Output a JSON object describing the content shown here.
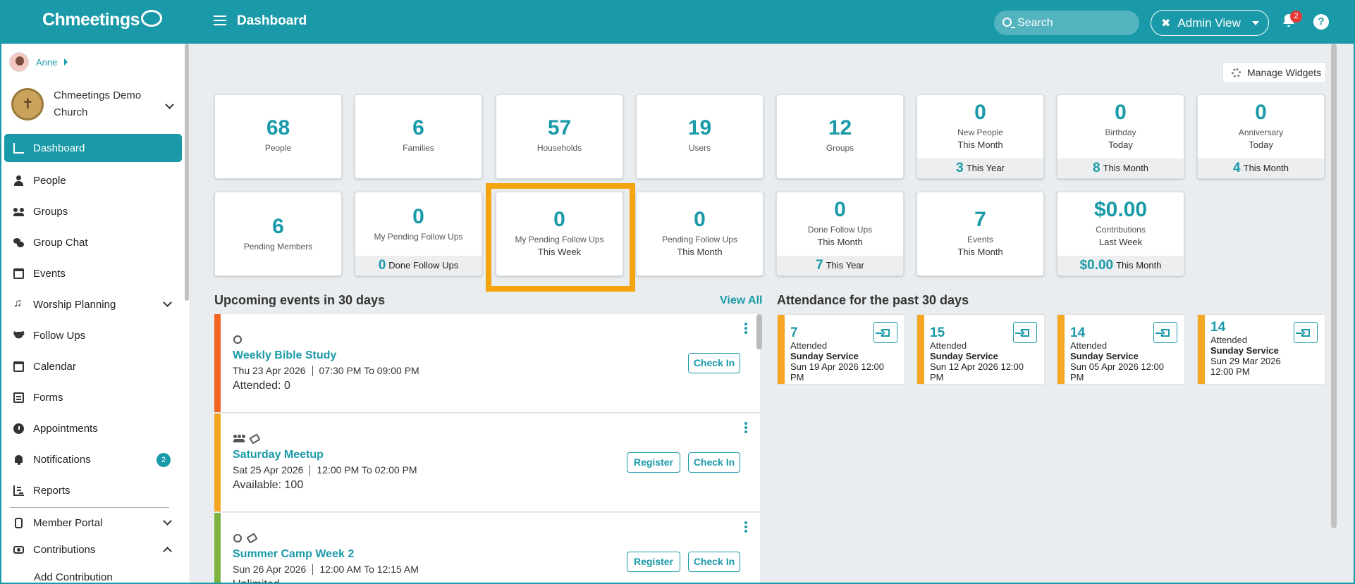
{
  "header": {
    "brand": "Chmeetings",
    "title": "Dashboard",
    "search_placeholder": "Search",
    "admin_view": "Admin View",
    "notif_count": "2",
    "help": "?"
  },
  "sidebar": {
    "user": "Anne",
    "church": "Chmeetings Demo Church",
    "items": [
      {
        "label": "Dashboard",
        "icon": "dashboard-icon"
      },
      {
        "label": "People",
        "icon": "person-icon"
      },
      {
        "label": "Groups",
        "icon": "groups-icon"
      },
      {
        "label": "Group Chat",
        "icon": "chat-icon"
      },
      {
        "label": "Events",
        "icon": "calendar-icon"
      },
      {
        "label": "Worship Planning",
        "icon": "music-icon"
      },
      {
        "label": "Follow Ups",
        "icon": "handshake-icon"
      },
      {
        "label": "Calendar",
        "icon": "calendar-icon"
      },
      {
        "label": "Forms",
        "icon": "forms-icon"
      },
      {
        "label": "Appointments",
        "icon": "clock-icon"
      },
      {
        "label": "Notifications",
        "icon": "bell-icon",
        "badge": "2"
      },
      {
        "label": "Reports",
        "icon": "reports-icon"
      },
      {
        "label": "Member Portal",
        "icon": "phone-icon"
      },
      {
        "label": "Contributions",
        "icon": "money-icon"
      },
      {
        "label": "Add Contribution"
      }
    ]
  },
  "manage_widgets": "Manage Widgets",
  "stats_row1": [
    {
      "num": "68",
      "label": "People"
    },
    {
      "num": "6",
      "label": "Families"
    },
    {
      "num": "57",
      "label": "Households"
    },
    {
      "num": "19",
      "label": "Users"
    },
    {
      "num": "12",
      "label": "Groups"
    },
    {
      "num": "0",
      "label": "New People",
      "sub": "This Month",
      "foot_num": "3",
      "foot": "This Year"
    },
    {
      "num": "0",
      "label": "Birthday",
      "sub": "Today",
      "foot_num": "8",
      "foot": "This Month"
    },
    {
      "num": "0",
      "label": "Anniversary",
      "sub": "Today",
      "foot_num": "4",
      "foot": "This Month"
    }
  ],
  "stats_row2": [
    {
      "num": "6",
      "label": "Pending Members"
    },
    {
      "num": "0",
      "label": "My Pending Follow Ups",
      "foot_num": "0",
      "foot": "Done Follow Ups"
    },
    {
      "num": "0",
      "label": "My Pending Follow Ups",
      "sub": "This Week"
    },
    {
      "num": "0",
      "label": "Pending Follow Ups",
      "sub": "This Month"
    },
    {
      "num": "0",
      "label": "Done Follow Ups",
      "sub": "This Month",
      "foot_num": "7",
      "foot": "This Year"
    },
    {
      "num": "7",
      "label": "Events",
      "sub": "This Month"
    },
    {
      "num": "$0.00",
      "label": "Contributions",
      "sub": "Last Week",
      "foot_num": "$0.00",
      "foot": "This Month"
    }
  ],
  "upcoming": {
    "title": "Upcoming events in 30 days",
    "view_all": "View All",
    "events": [
      {
        "name": "Weekly Bible Study",
        "date": "Thu 23 Apr  2026",
        "time": "07:30 PM To 09:00 PM",
        "meta": "Attended: 0",
        "color": "#f26522",
        "register": false
      },
      {
        "name": "Saturday Meetup",
        "date": "Sat 25 Apr  2026",
        "time": "12:00 PM To 02:00 PM",
        "meta": "Available: 100",
        "color": "#f5a623",
        "register": true
      },
      {
        "name": "Summer Camp Week 2",
        "date": "Sun 26 Apr  2026",
        "time": "12:00 AM To 12:15 AM",
        "meta": "Unlimited",
        "color": "#7cb342",
        "register": true
      }
    ],
    "register_label": "Register",
    "checkin_label": "Check In"
  },
  "attendance": {
    "title": "Attendance for the past 30 days",
    "cards": [
      {
        "num": "7",
        "label": "Attended",
        "name": "Sunday Service",
        "date": "Sun 19 Apr 2026 12:00 PM"
      },
      {
        "num": "15",
        "label": "Attended",
        "name": "Sunday Service",
        "date": "Sun 12 Apr 2026 12:00 PM"
      },
      {
        "num": "14",
        "label": "Attended",
        "name": "Sunday Service",
        "date": "Sun 05 Apr 2026 12:00 PM"
      },
      {
        "num": "14",
        "label": "Attended",
        "name": "Sunday Service",
        "date": "Sun 29 Mar 2026 12:00 PM"
      }
    ]
  }
}
